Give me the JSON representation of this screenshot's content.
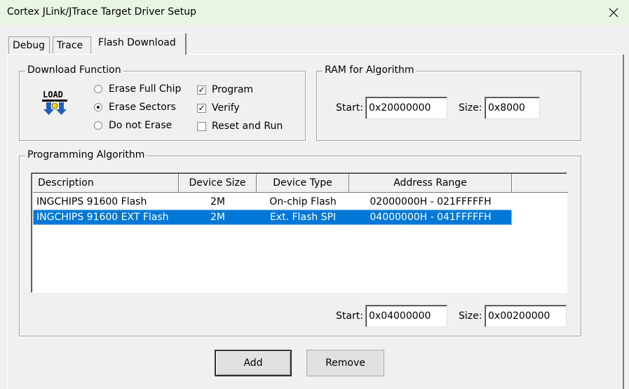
{
  "window": {
    "title": "Cortex JLink/JTrace Target Driver Setup",
    "close_icon": "close-icon"
  },
  "tabs": [
    {
      "label": "Debug"
    },
    {
      "label": "Trace"
    },
    {
      "label": "Flash Download"
    }
  ],
  "download_function": {
    "label": "Download Function",
    "icon_text": "LOAD",
    "radios": [
      {
        "label": "Erase Full Chip",
        "checked": false
      },
      {
        "label": "Erase Sectors",
        "checked": true
      },
      {
        "label": "Do not Erase",
        "checked": false
      }
    ],
    "checks": [
      {
        "label": "Program",
        "checked": true,
        "mark": "✓"
      },
      {
        "label": "Verify",
        "checked": true,
        "mark": "✓"
      },
      {
        "label": "Reset and Run",
        "checked": false,
        "mark": ""
      }
    ]
  },
  "ram": {
    "label": "RAM for Algorithm",
    "start_label": "Start:",
    "start_value": "0x20000000",
    "size_label": "Size:",
    "size_value": "0x8000"
  },
  "programming": {
    "label": "Programming Algorithm",
    "columns": [
      "Description",
      "Device Size",
      "Device Type",
      "Address Range"
    ],
    "rows": [
      {
        "description": "INGCHIPS 91600 Flash",
        "size": "2M",
        "type": "On-chip Flash",
        "range": "02000000H - 021FFFFFH",
        "selected": false
      },
      {
        "description": "INGCHIPS 91600 EXT Flash",
        "size": "2M",
        "type": "Ext. Flash SPI",
        "range": "04000000H - 041FFFFFH",
        "selected": true
      }
    ],
    "start_label": "Start:",
    "start_value": "0x04000000",
    "size_label": "Size:",
    "size_value": "0x00200000"
  },
  "buttons": {
    "add": "Add",
    "remove": "Remove"
  },
  "colors": {
    "titlebar": "#e8f5e3",
    "selection": "#0078d7"
  }
}
